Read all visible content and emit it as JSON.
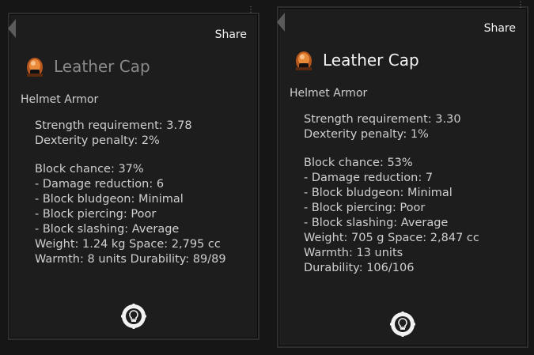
{
  "panels": [
    {
      "share_label": "Share",
      "title": "Leather Cap",
      "subtitle": "Helmet Armor",
      "icon": "leather-cap-helmet-icon",
      "lines": [
        "Strength requirement: 3.78",
        "Dexterity penalty: 2%",
        "",
        "Block chance: 37%",
        "- Damage reduction: 6",
        "- Block bludgeon: Minimal",
        "- Block piercing: Poor",
        "- Block slashing: Average",
        "Weight: 1.24 kg  Space: 2,795 cc",
        "Warmth: 8 units  Durability: 89/89"
      ],
      "footer_icon": "bulb-gear-icon"
    },
    {
      "share_label": "Share",
      "title": "Leather Cap",
      "subtitle": "Helmet Armor",
      "icon": "leather-cap-helmet-icon",
      "lines": [
        "Strength requirement: 3.30",
        "Dexterity penalty: 1%",
        "",
        "Block chance: 53%",
        "- Damage reduction: 7",
        "- Block bludgeon: Minimal",
        "- Block piercing: Poor",
        "- Block slashing: Average",
        "Weight: 705 g  Space: 2,847 cc",
        "Warmth: 13 units",
        "Durability: 106/106"
      ],
      "footer_icon": "bulb-gear-icon"
    }
  ],
  "colors": {
    "panel_bg": "#1d1d1d",
    "panel_border": "#2e2e2e",
    "title_dim": "#8a8a8a",
    "title_bright": "#f2f2f2",
    "text": "#cfcfcf"
  }
}
